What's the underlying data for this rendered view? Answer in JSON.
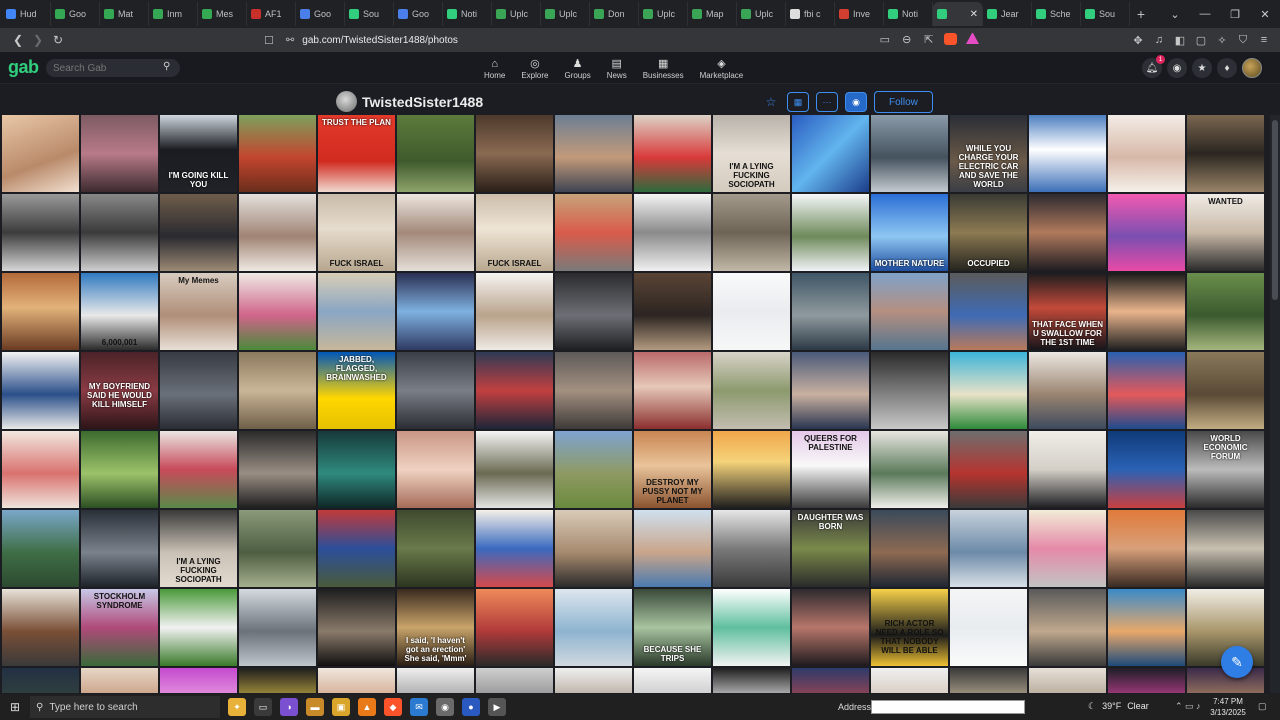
{
  "browser": {
    "tabs": [
      {
        "title": "Hud",
        "color": "#4285f4"
      },
      {
        "title": "Goo",
        "color": "#34a853"
      },
      {
        "title": "Mat",
        "color": "#34a853"
      },
      {
        "title": "Inm",
        "color": "#34a853"
      },
      {
        "title": "Mes",
        "color": "#34a853"
      },
      {
        "title": "AF1",
        "color": "#c9302c"
      },
      {
        "title": "Goo",
        "color": "#4a7ee8"
      },
      {
        "title": "Sou",
        "color": "#30ce7d"
      },
      {
        "title": "Goo",
        "color": "#4a7ee8"
      },
      {
        "title": "Noti",
        "color": "#30ce7d"
      },
      {
        "title": "Uplc",
        "color": "#3aa655"
      },
      {
        "title": "Uplc",
        "color": "#3aa655"
      },
      {
        "title": "Don",
        "color": "#3aa655"
      },
      {
        "title": "Uplc",
        "color": "#3aa655"
      },
      {
        "title": "Map",
        "color": "#3aa655"
      },
      {
        "title": "Uplc",
        "color": "#3aa655"
      },
      {
        "title": "fbi c",
        "color": "#dddddd"
      },
      {
        "title": "Inve",
        "color": "#d23f31"
      },
      {
        "title": "Noti",
        "color": "#30ce7d"
      },
      {
        "title": "",
        "color": "#30ce7d",
        "active": true
      },
      {
        "title": "Jear",
        "color": "#30ce7d"
      },
      {
        "title": "Sche",
        "color": "#30ce7d"
      },
      {
        "title": "Sou",
        "color": "#30ce7d"
      }
    ],
    "active_tab_close": "✕",
    "new_tab": "+",
    "url": "gab.com/TwistedSister1488/photos"
  },
  "gab": {
    "logo": "gab",
    "search_placeholder": "Search Gab",
    "nav": [
      {
        "label": "Home",
        "icon": "home-icon",
        "glyph": "⌂"
      },
      {
        "label": "Explore",
        "icon": "globe-icon",
        "glyph": "◎"
      },
      {
        "label": "Groups",
        "icon": "groups-icon",
        "glyph": "♟"
      },
      {
        "label": "News",
        "icon": "news-icon",
        "glyph": "▤"
      },
      {
        "label": "Businesses",
        "icon": "businesses-icon",
        "glyph": "▦"
      },
      {
        "label": "Marketplace",
        "icon": "marketplace-icon",
        "glyph": "◈"
      }
    ],
    "notification_count": "1",
    "accent": "#30ce7d"
  },
  "profile": {
    "username": "TwistedSister1488",
    "follow_label": "Follow",
    "accent": "#3d8ef0"
  },
  "photos": [
    {
      "bg": "linear-gradient(160deg,#e8c7a6,#b98a6a 60%,#f2e0d0)"
    },
    {
      "bg": "linear-gradient(180deg,#7d5b63,#b87a88 50%,#3d2b30)"
    },
    {
      "bg": "linear-gradient(180deg,#cfd6dd,#1a1c22 45%,#202228)",
      "caption": "I'M GOING KILL YOU",
      "pos": "bot",
      "tone": "light"
    },
    {
      "bg": "linear-gradient(180deg,#7da05c,#c2452f 55%,#6b2e1c)"
    },
    {
      "bg": "linear-gradient(180deg,#e33b2b,#d12a1f 60%,#f0d9cf)",
      "caption": "TRUST THE PLAN",
      "pos": "top",
      "tone": "light"
    },
    {
      "bg": "linear-gradient(180deg,#5c7b3c,#3f5a2c 60%,#8fa46c)"
    },
    {
      "bg": "linear-gradient(180deg,#4d3a2d,#8a6a52 50%,#2a1f18)"
    },
    {
      "bg": "linear-gradient(180deg,#6c7e93,#c39a7a 55%,#3e4452)"
    },
    {
      "bg": "linear-gradient(180deg,#dcd2c6,#d93a3a 55%,#2d6a3d)"
    },
    {
      "bg": "linear-gradient(180deg,#b8b2aa,#e5ded4 50%,#d4cbbe)",
      "caption": "I'M A LYING FUCKING SOCIOPATH",
      "pos": "bot"
    },
    {
      "bg": "linear-gradient(135deg,#2a5cc0,#62b5ee 50%,#1c3d8a)"
    },
    {
      "bg": "linear-gradient(180deg,#8a9aa8,#44525e 55%,#c4cad0)"
    },
    {
      "bg": "linear-gradient(180deg,#2a2e36,#6b5a48 60%,#3a3e46)",
      "caption": "WHILE YOU CHARGE YOUR ELECTRIC CAR AND SAVE THE WORLD",
      "pos": "bot",
      "tone": "light"
    },
    {
      "bg": "linear-gradient(180deg,#4c7fc0,#ffffff 45%,#3d6fb8)"
    },
    {
      "bg": "linear-gradient(180deg,#f3ece6,#d7b8a8 55%,#f5f0ea)"
    },
    {
      "bg": "linear-gradient(180deg,#7a6650,#2a2620 50%,#9a8468)"
    },
    {
      "bg": "linear-gradient(180deg,#9a9a9a,#3c3c3c 50%,#d6d6d6)"
    },
    {
      "bg": "linear-gradient(180deg,#888,#3a3a3a 50%,#cfcfcf)"
    },
    {
      "bg": "linear-gradient(180deg,#6f5d4a,#2a2a30 55%,#9c8a74)"
    },
    {
      "bg": "linear-gradient(180deg,#e4e0dc,#a08474 55%,#efe9e3)"
    },
    {
      "bg": "linear-gradient(180deg,#c9bba9,#e6dccd 45%,#b8a78f)",
      "caption": "FUCK ISRAEL",
      "pos": "bot"
    },
    {
      "bg": "linear-gradient(180deg,#ece6df,#a3897a 50%,#e5dfd8)"
    },
    {
      "bg": "linear-gradient(180deg,#cbbda9,#efe5d6 45%,#b9a88f)",
      "caption": "FUCK ISRAEL",
      "pos": "bot"
    },
    {
      "bg": "linear-gradient(180deg,#c7a37a,#d95b4a 50%,#7a7a7a)"
    },
    {
      "bg": "linear-gradient(180deg,#f4f4f4,#8a8a8a 50%,#f0f0f0)"
    },
    {
      "bg": "linear-gradient(180deg,#a39a8b,#6d6456 50%,#c1b8a7)"
    },
    {
      "bg": "linear-gradient(180deg,#f5f7fa,#6e8a5a 55%,#f1f3f6)"
    },
    {
      "bg": "linear-gradient(180deg,#2b6ed6,#8ec7f2 55%,#1e4e9e)",
      "caption": "MOTHER NATURE",
      "pos": "bot",
      "tone": "light"
    },
    {
      "bg": "linear-gradient(180deg,#3a3a34,#8c7a52 50%,#24241f)",
      "caption": "OCCUPIED",
      "pos": "bot",
      "tone": "light"
    },
    {
      "bg": "linear-gradient(180deg,#2d2a30,#b07a5c 50%,#1e1c22)"
    },
    {
      "bg": "linear-gradient(180deg,#f25ab1,#7a4fb0 55%,#e94aa6)"
    },
    {
      "bg": "linear-gradient(180deg,#f0ece6,#c9b9a8 50%,#2a2a2a)",
      "caption": "WANTED",
      "pos": "top"
    },
    {
      "bg": "linear-gradient(180deg,#b36a3a,#e2b27a 45%,#6a3b22)"
    },
    {
      "bg": "linear-gradient(180deg,#2f7ac0,#e9e9e9 55%,#2b2b2b)",
      "caption": "6,000,001",
      "pos": "bot"
    },
    {
      "bg": "linear-gradient(180deg,#d8ccc0,#b08e78 55%,#e8dfd6)",
      "caption": "My Memes",
      "pos": "top"
    },
    {
      "bg": "linear-gradient(180deg,#efeae4,#d0648a 55%,#4a8a3a)"
    },
    {
      "bg": "linear-gradient(180deg,#d9ceb6,#8aa6c4 50%,#c7b79a)"
    },
    {
      "bg": "linear-gradient(180deg,#2a2f52,#7fb1e0 50%,#2f3a63)"
    },
    {
      "bg": "linear-gradient(180deg,#f6f4f1,#b9a38c 55%,#eeeae4)"
    },
    {
      "bg": "linear-gradient(180deg,#2b2b2e,#6d6f76 55%,#1f1f22)"
    },
    {
      "bg": "linear-gradient(180deg,#5a4434,#2c2522 55%,#b39a80)"
    },
    {
      "bg": "linear-gradient(180deg,#fafafa,#e9ecef 50%,#f7f7f7)"
    },
    {
      "bg": "linear-gradient(180deg,#3f5566,#8f9a9e 55%,#2c3a46)"
    },
    {
      "bg": "linear-gradient(180deg,#7fa2c9,#b58f80 50%,#55758f)"
    },
    {
      "bg": "linear-gradient(180deg,#5b5b5b,#3f6bb5 55%,#b87a5a)"
    },
    {
      "bg": "linear-gradient(180deg,#1c1c1e,#c34a3a 45%,#15151a)",
      "caption": "THAT FACE WHEN U SWALLOW FOR THE 1ST TIME",
      "pos": "bot",
      "tone": "light"
    },
    {
      "bg": "linear-gradient(180deg,#1a1a1a,#e9b48c 50%,#202020)"
    },
    {
      "bg": "linear-gradient(180deg,#6a8e4c,#3b5a2e 55%,#a5b67e)"
    },
    {
      "bg": "linear-gradient(180deg,#f3f3f3,#2b4f8a 55%,#e8e8e8)"
    },
    {
      "bg": "linear-gradient(180deg,#4a2328,#8b3b44 50%,#2c1518)",
      "caption": "MY BOYFRIEND SAID HE WOULD KILL HIMSELF",
      "pos": "mid",
      "tone": "light"
    },
    {
      "bg": "linear-gradient(180deg,#373b42,#6a707a 55%,#2a2d33)"
    },
    {
      "bg": "linear-gradient(180deg,#8c7a5e,#c9b597 50%,#6f5f48)"
    },
    {
      "bg": "linear-gradient(180deg,#0057b7,#ffd700 60%,#e6c100)",
      "caption": "JABBED, FLAGGED, BRAINWASHED",
      "pos": "top",
      "tone": "light"
    },
    {
      "bg": "linear-gradient(180deg,#3a3e45,#7a7e86 50%,#2a2d32)"
    },
    {
      "bg": "linear-gradient(180deg,#2e3a55,#c24040 50%,#1e2638)"
    },
    {
      "bg": "linear-gradient(180deg,#5e5a58,#a39081 50%,#3d3a38)"
    },
    {
      "bg": "linear-gradient(180deg,#b96a6a,#e6c8b8 45%,#8b2f2f)"
    },
    {
      "bg": "linear-gradient(180deg,#d8d3c8,#8c9a6e 50%,#c3bdb0)"
    },
    {
      "bg": "linear-gradient(180deg,#4a5a7a,#c9b0a0 55%,#2a3550)"
    },
    {
      "bg": "linear-gradient(180deg,#2a2a2a,#7a7a7a 50%,#c8c8c8)"
    },
    {
      "bg": "linear-gradient(180deg,#3cb4d8,#e8e2c8 55%,#2e8a3a)"
    },
    {
      "bg": "linear-gradient(180deg,#ece8e2,#9a8470 55%,#3d4a5e)"
    },
    {
      "bg": "linear-gradient(180deg,#2860b0,#e45a5a 55%,#1d4b8e)"
    },
    {
      "bg": "linear-gradient(180deg,#8a7a5a,#5a4a36 55%,#c2ad82)"
    },
    {
      "bg": "linear-gradient(180deg,#f2e7df,#d9726f 55%,#efe4dc)"
    },
    {
      "bg": "linear-gradient(180deg,#3c6b2e,#9cc26a 55%,#2c4f22)"
    },
    {
      "bg": "linear-gradient(180deg,#e9e6e2,#c84a5a 50%,#5a8a4a)"
    },
    {
      "bg": "linear-gradient(180deg,#2b2b2b,#9a8e84 55%,#1e1e1e)"
    },
    {
      "bg": "linear-gradient(180deg,#173a3a,#2f8a7e 55%,#0f2626)"
    },
    {
      "bg": "linear-gradient(180deg,#c99684,#f0d2c2 50%,#a56c58)"
    },
    {
      "bg": "linear-gradient(180deg,#f5f5f5,#6a6a52 55%,#e4e4e4)"
    },
    {
      "bg": "linear-gradient(180deg,#7ea3d0,#8e9a62 55%,#6a8a3e)"
    },
    {
      "bg": "linear-gradient(180deg,#c98552,#e9c49a 45%,#8b5330)",
      "caption": "DESTROY MY PUSSY NOT MY PLANET",
      "pos": "bot"
    },
    {
      "bg": "linear-gradient(180deg,#f0a64a,#f5d37a 40%,#1e1e1e)"
    },
    {
      "bg": "linear-gradient(180deg,#e4c8e8,#f8f8f8 45%,#3a3a3a)",
      "caption": "QUEERS FOR PALESTINE",
      "pos": "top"
    },
    {
      "bg": "linear-gradient(180deg,#e8e6e0,#5a7a5a 55%,#f0eeea)"
    },
    {
      "bg": "linear-gradient(180deg,#6e6e6e,#b6342f 55%,#3a3a3a)"
    },
    {
      "bg": "linear-gradient(180deg,#f0eee8,#d4cfc7 50%,#1e1e22)"
    },
    {
      "bg": "linear-gradient(180deg,#0f3a78,#2a62b5 50%,#c94040)"
    },
    {
      "bg": "linear-gradient(180deg,#4a4a4a,#bcbcbc 50%,#2a2a2a)",
      "caption": "WORLD ECONOMIC FORUM",
      "pos": "top",
      "tone": "light"
    },
    {
      "bg": "linear-gradient(180deg,#7aa7c9,#3f6e46 55%,#2c4a30)"
    },
    {
      "bg": "linear-gradient(180deg,#2a3038,#7a828c 55%,#1e232a)"
    },
    {
      "bg": "linear-gradient(180deg,#3a3a3a,#c9c1b5 55%,#e3dbcf)",
      "caption": "I'M A LYING FUCKING SOCIOPATH",
      "pos": "bot"
    },
    {
      "bg": "linear-gradient(180deg,#8a9a7a,#4e5e42 55%,#a5b08e)"
    },
    {
      "bg": "linear-gradient(180deg,#c23a3a,#2b4f9a 50%,#4a5a3a)"
    },
    {
      "bg": "linear-gradient(180deg,#3f4a2e,#6a7a4a 50%,#2c3520)"
    },
    {
      "bg": "linear-gradient(180deg,#f5f0e8,#3a6ac0 50%,#d64a4a)"
    },
    {
      "bg": "linear-gradient(180deg,#d9cbb9,#a78a6e 55%,#2b2b2b)"
    },
    {
      "bg": "linear-gradient(180deg,#cfe0ef,#c9a58a 55%,#4a7ab0)"
    },
    {
      "bg": "linear-gradient(180deg,#e6e6e6,#7a7a7a 50%,#3a3a3a)"
    },
    {
      "bg": "linear-gradient(180deg,#3a3a3a,#7a8a4a 50%,#2a2a2a)",
      "caption": "DAUGHTER WAS BORN",
      "pos": "top",
      "tone": "light"
    },
    {
      "bg": "linear-gradient(180deg,#3a4a5a,#8e6a52 55%,#1e2632)"
    },
    {
      "bg": "linear-gradient(180deg,#c7d2dc,#6c8aa8 55%,#d9e0e6)"
    },
    {
      "bg": "linear-gradient(180deg,#f2ecd8,#e58aa8 50%,#c3c3c3)"
    },
    {
      "bg": "linear-gradient(180deg,#e07a3a,#d8a07a 50%,#3a2a22)"
    },
    {
      "bg": "linear-gradient(180deg,#4a4a4a,#c8c0b0 50%,#2a2a2a)"
    },
    {
      "bg": "linear-gradient(180deg,#e7e2d8,#7a4f36 55%,#3a3a3a)"
    },
    {
      "bg": "linear-gradient(180deg,#c8c8e8,#b04a7a 50%,#3a6a3a)",
      "caption": "STOCKHOLM SYNDROME",
      "pos": "top"
    },
    {
      "bg": "linear-gradient(180deg,#4a9a3a,#f2f2f2 50%,#3a7a2a)"
    },
    {
      "bg": "linear-gradient(180deg,#d4dadf,#6a727a 55%,#bfc6cc)"
    },
    {
      "bg": "linear-gradient(180deg,#1e1e1e,#8a7a6a 55%,#101010)"
    },
    {
      "bg": "linear-gradient(180deg,#3a2a1e,#c9a46a 50%,#2a1e14)",
      "caption": "I said, 'I haven't got an erection' She said, 'Mmm'",
      "pos": "bot",
      "tone": "light"
    },
    {
      "bg": "linear-gradient(180deg,#ef8a5a,#b03a3a 55%,#2a2a2a)"
    },
    {
      "bg": "linear-gradient(180deg,#dde6ee,#8eb4d0 55%,#d1d8df)"
    },
    {
      "bg": "linear-gradient(180deg,#3a4a3a,#a8c4a0 50%,#2a3a2a)",
      "caption": "BECAUSE SHE TRIPS",
      "pos": "bot",
      "tone": "light"
    },
    {
      "bg": "linear-gradient(180deg,#ffffff,#5fbf9e 50%,#f2f2f2)"
    },
    {
      "bg": "linear-gradient(180deg,#2e2a2e,#b7766a 50%,#1e1a1e)"
    },
    {
      "bg": "linear-gradient(180deg,#f7d24a,#1a1a1a 60%,#f0c233)",
      "caption": "RICH ACTOR NEED A ROLE SO THAT NOBODY WILL BE ABLE",
      "pos": "mid"
    },
    {
      "bg": "linear-gradient(180deg,#f5f5f5,#e8ecef 50%,#fafafa)"
    },
    {
      "bg": "linear-gradient(180deg,#5a5a5a,#bfa88e 55%,#3a3a3a)"
    },
    {
      "bg": "linear-gradient(180deg,#3a8ac8,#e8a86a 55%,#1e4a7a)"
    },
    {
      "bg": "linear-gradient(180deg,#f1ede6,#a8966a 55%,#3a3a2a)"
    },
    {
      "bg": "linear-gradient(180deg,#223044,#3a4a3a 60%,#1c2530)"
    },
    {
      "bg": "linear-gradient(180deg,#e6d7c6,#b97e5e 60%,#2a2a2a)"
    },
    {
      "bg": "linear-gradient(180deg,#c44ad0,#f2b5e2 55%,#6a3a7a)"
    },
    {
      "bg": "linear-gradient(180deg,#1e1e1e,#e8c94a 55%,#1a1a1a)"
    },
    {
      "bg": "linear-gradient(180deg,#efe6dc,#c79272 55%,#e2d3c3)"
    },
    {
      "bg": "linear-gradient(180deg,#eee,#8a8a8a 55%,#ccc)"
    },
    {
      "bg": "linear-gradient(180deg,#cfcfcf,#7a7a7a 55%,#5a5a5a)"
    },
    {
      "bg": "linear-gradient(180deg,#efefef,#a09080 55%,#dcdcdc)"
    },
    {
      "bg": "linear-gradient(180deg,#f5f5f5,#b8b8b8 55%,#e0e0e0)"
    },
    {
      "bg": "linear-gradient(180deg,#1e1e1e,#f2f2f2 50%,#161616)"
    },
    {
      "bg": "linear-gradient(180deg,#2e3a6a,#c04a4a 55%,#1e2850)"
    },
    {
      "bg": "linear-gradient(180deg,#f0f0f0,#c9b8a8 55%,#dedede)"
    },
    {
      "bg": "linear-gradient(180deg,#3a3a3a,#d8c8a8 55%,#2a2a2a)"
    },
    {
      "bg": "linear-gradient(180deg,#e6e0d8,#a0907a 55%,#3a3a3a)"
    },
    {
      "bg": "linear-gradient(180deg,#1e1e28,#e84aa8 55%,#2a2a3a)"
    },
    {
      "bg": "linear-gradient(180deg,#3a2a4a,#c99a6a 55%,#2a1e36)"
    }
  ],
  "taskbar": {
    "search_placeholder": "Type here to search",
    "address_label": "Address",
    "weather": "39°F",
    "weather_desc": "Clear",
    "time": "7:47 PM",
    "date": "3/13/2025",
    "apps": [
      {
        "name": "sparkle-app-icon",
        "color": "#e8b23a",
        "glyph": "✦"
      },
      {
        "name": "task-view-icon",
        "color": "#3a3a3a",
        "glyph": "▭"
      },
      {
        "name": "copilot-icon",
        "color": "#7a4fd0",
        "glyph": "◑"
      },
      {
        "name": "folder-app-icon",
        "color": "#c98b2a",
        "glyph": "▬"
      },
      {
        "name": "explorer-icon",
        "color": "#d9a52a",
        "glyph": "▣"
      },
      {
        "name": "vlc-icon",
        "color": "#e87a1a",
        "glyph": "▲"
      },
      {
        "name": "brave-app-icon",
        "color": "#fb542b",
        "glyph": "◆"
      },
      {
        "name": "mail-app-icon",
        "color": "#2a7ad0",
        "glyph": "✉"
      },
      {
        "name": "screenshot-app-icon",
        "color": "#6a6a6a",
        "glyph": "◉"
      },
      {
        "name": "recorder-app-icon",
        "color": "#2a5ac0",
        "glyph": "●"
      },
      {
        "name": "media-player-icon",
        "color": "#555",
        "glyph": "▶"
      }
    ]
  }
}
